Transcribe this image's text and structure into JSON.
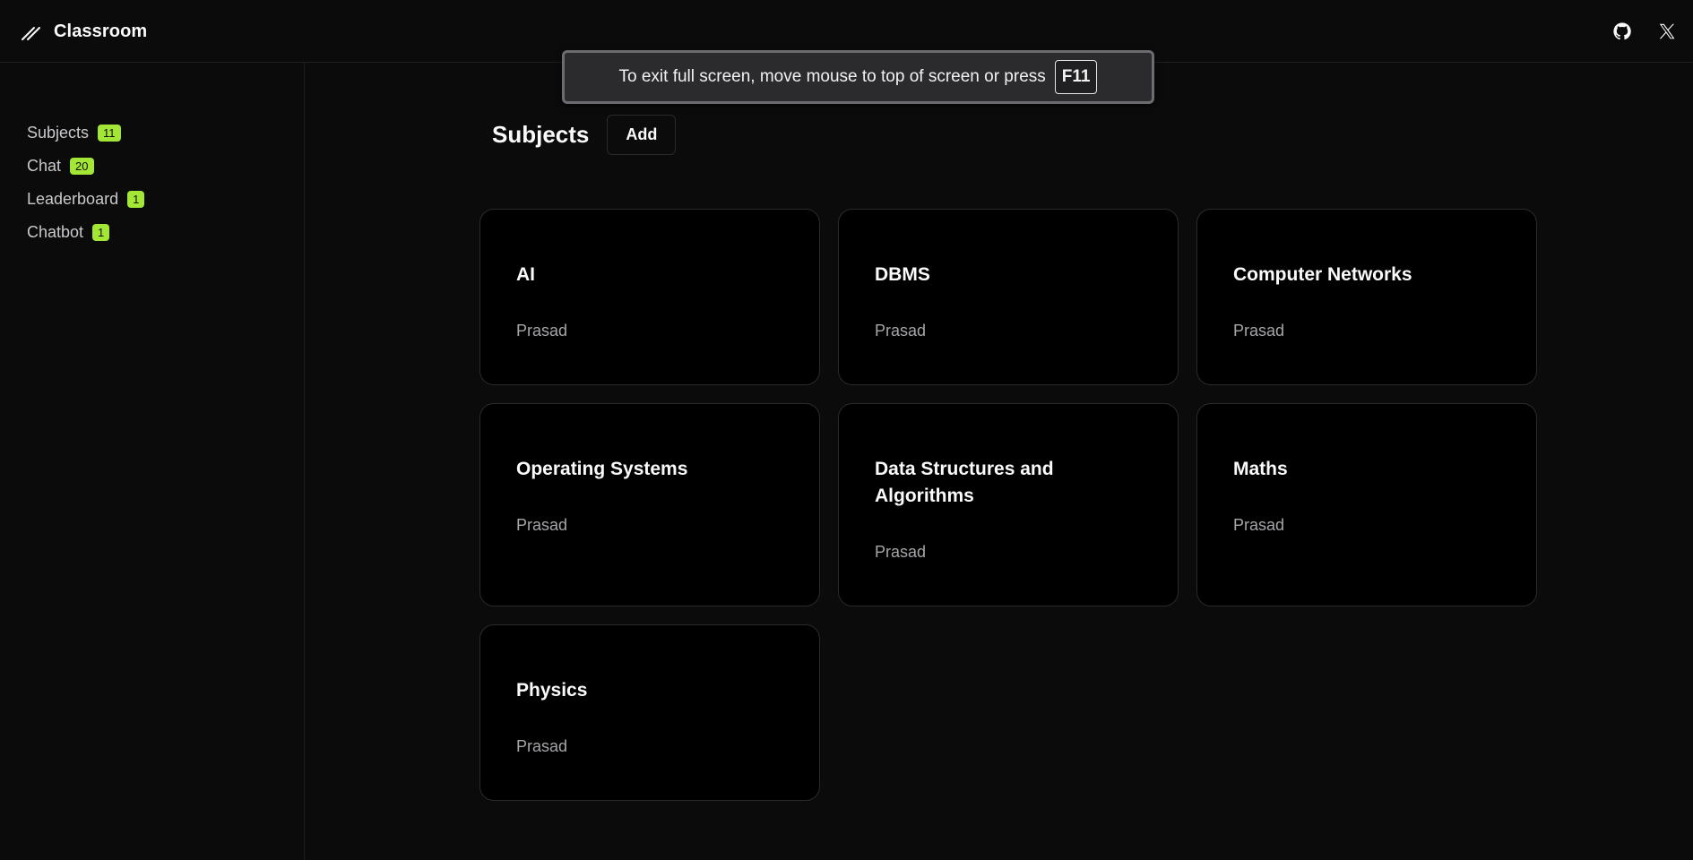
{
  "app": {
    "title": "Classroom"
  },
  "header": {
    "icons": [
      "github-icon",
      "x-icon"
    ]
  },
  "sidebar": {
    "items": [
      {
        "label": "Subjects",
        "badge": "11"
      },
      {
        "label": "Chat",
        "badge": "20"
      },
      {
        "label": "Leaderboard",
        "badge": "1"
      },
      {
        "label": "Chatbot",
        "badge": "1"
      }
    ]
  },
  "fullscreen_banner": {
    "text": "To exit full screen, move mouse to top of screen or press",
    "key": "F11"
  },
  "main": {
    "title": "Subjects",
    "add_label": "Add",
    "cards": [
      {
        "title": "AI",
        "owner": "Prasad"
      },
      {
        "title": "DBMS",
        "owner": "Prasad"
      },
      {
        "title": "Computer Networks",
        "owner": "Prasad"
      },
      {
        "title": "Operating Systems",
        "owner": "Prasad"
      },
      {
        "title": "Data Structures and Algorithms",
        "owner": "Prasad"
      },
      {
        "title": "Maths",
        "owner": "Prasad"
      },
      {
        "title": "Physics",
        "owner": "Prasad"
      }
    ]
  },
  "colors": {
    "accent": "#a3e635",
    "background": "#0b0b0c",
    "card": "#000000"
  }
}
